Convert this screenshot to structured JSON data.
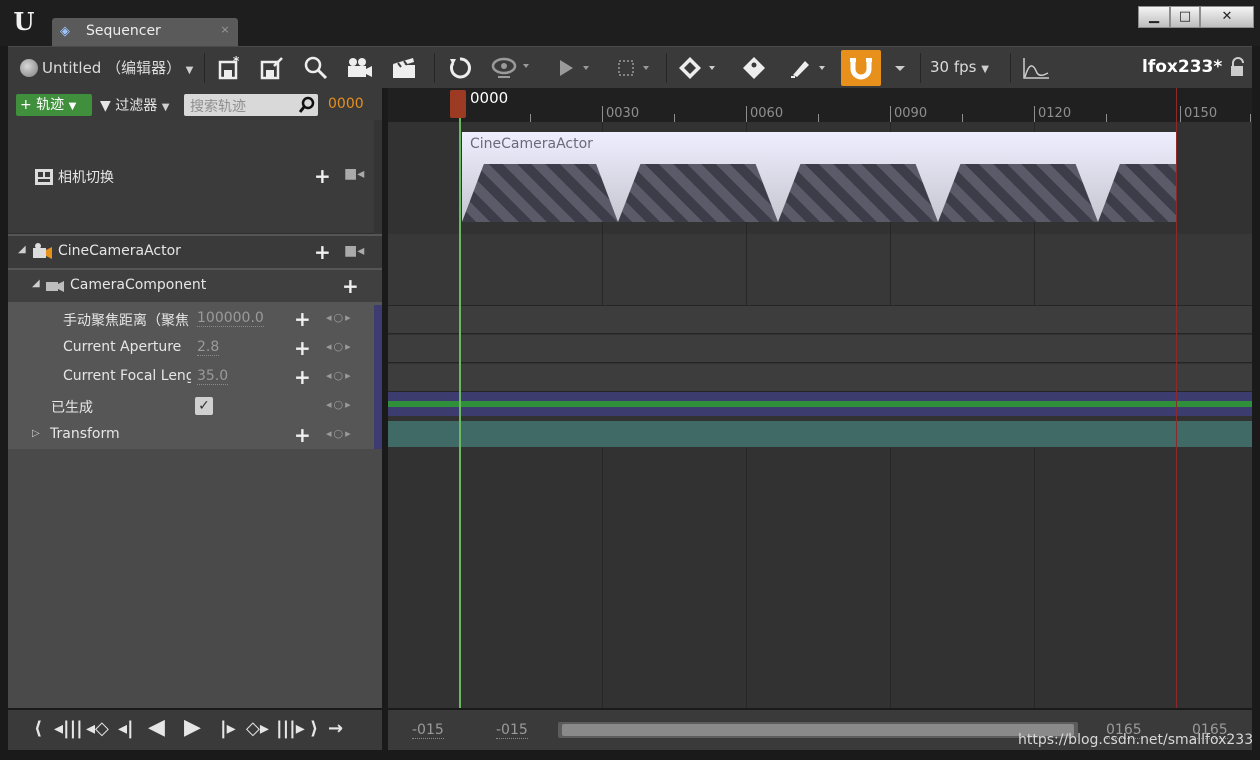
{
  "window": {
    "logo_text": "U",
    "tab_label": "Sequencer",
    "tab_close": "×",
    "minimize": "▁",
    "maximize": "□",
    "close": "✕"
  },
  "toolbar": {
    "level_label": "Untitled （编辑器）",
    "fps_label": "30 fps",
    "user_label": "lfox233*",
    "icons": [
      "save-icon",
      "save-as-icon",
      "find-icon",
      "camera-icon",
      "render-icon",
      "restore-icon",
      "visibility-icon",
      "play-icon",
      "select-icon",
      "key-icon",
      "tag-icon",
      "brush-icon",
      "snap-magnet-icon",
      "curve-icon",
      "lock-icon"
    ],
    "accent_color": "#e7901b"
  },
  "left_panel": {
    "add_track_label": "+ 轨迹",
    "filter_label": "过滤器",
    "search_placeholder": "搜索轨迹",
    "time_display": "0000",
    "camera_cut_label": "相机切换",
    "actor_label": "CineCameraActor",
    "component_label": "CameraComponent",
    "properties": [
      {
        "label": "手动聚焦距离（聚焦",
        "value": "100000.0"
      },
      {
        "label": "Current Aperture",
        "value": "2.8"
      },
      {
        "label": "Current Focal Leng",
        "value": "35.0"
      }
    ],
    "spawned_label": "已生成",
    "transform_label": "Transform"
  },
  "timeline": {
    "playhead_label": "0000",
    "ticks": [
      "0030",
      "0060",
      "0090",
      "0120",
      "0150"
    ],
    "camera_track_label": "CineCameraActor"
  },
  "bottom": {
    "range_start_1": "-015",
    "range_start_2": "-015",
    "range_end_1": "0165",
    "range_end_2": "0165"
  },
  "watermark": "https://blog.csdn.net/smallfox233"
}
